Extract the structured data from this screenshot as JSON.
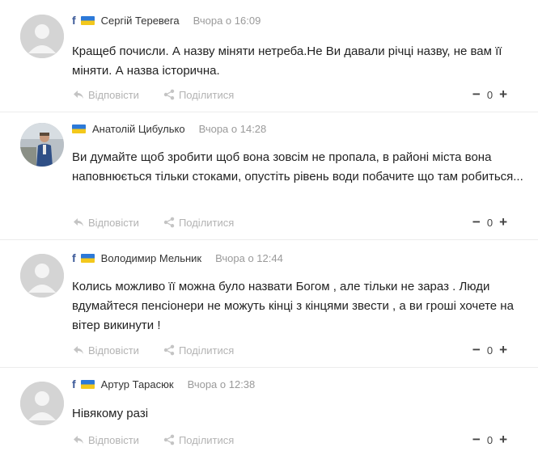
{
  "actions": {
    "reply_label": "Відповісти",
    "share_label": "Поділитися"
  },
  "vote": {
    "minus": "−",
    "plus": "+"
  },
  "comments": [
    {
      "author": "Сергій Теревега",
      "time": "Вчора о 16:09",
      "text": "Кращеб почисли. А назву міняти нетреба.Не Ви давали річці назву, не вам її міняти. А назва історична.",
      "score": "0",
      "has_facebook": true
    },
    {
      "author": "Анатолій Цибулько",
      "time": "Вчора о 14:28",
      "text": "Ви думайте щоб зробити щоб вона зовсім не пропала, в районі міста вона наповнюється тільки стоками, опустіть рівень води побачите що там робиться...",
      "score": "0",
      "has_facebook": false
    },
    {
      "author": "Володимир Мельник",
      "time": "Вчора о 12:44",
      "text": "Колись можливо її можна було назвати Богом , але тільки не зараз . Люди вдумайтеся пенсіонери не можуть кінці з кінцями звести , а ви гроші хочете на вітер викинути !",
      "score": "0",
      "has_facebook": true
    },
    {
      "author": "Артур Тарасюк",
      "time": "Вчора о 12:38",
      "text": "Нівякому разі",
      "score": "0",
      "has_facebook": true
    }
  ],
  "icons": {
    "facebook": "f",
    "flag": "ukraine-flag-icon",
    "reply": "reply-arrow-icon",
    "share": "share-icon"
  },
  "colors": {
    "flag_blue": "#2c79d8",
    "flag_yellow": "#f3c81c",
    "facebook": "#3b5998",
    "muted": "#b3b3b3",
    "time": "#9a9a9a"
  }
}
